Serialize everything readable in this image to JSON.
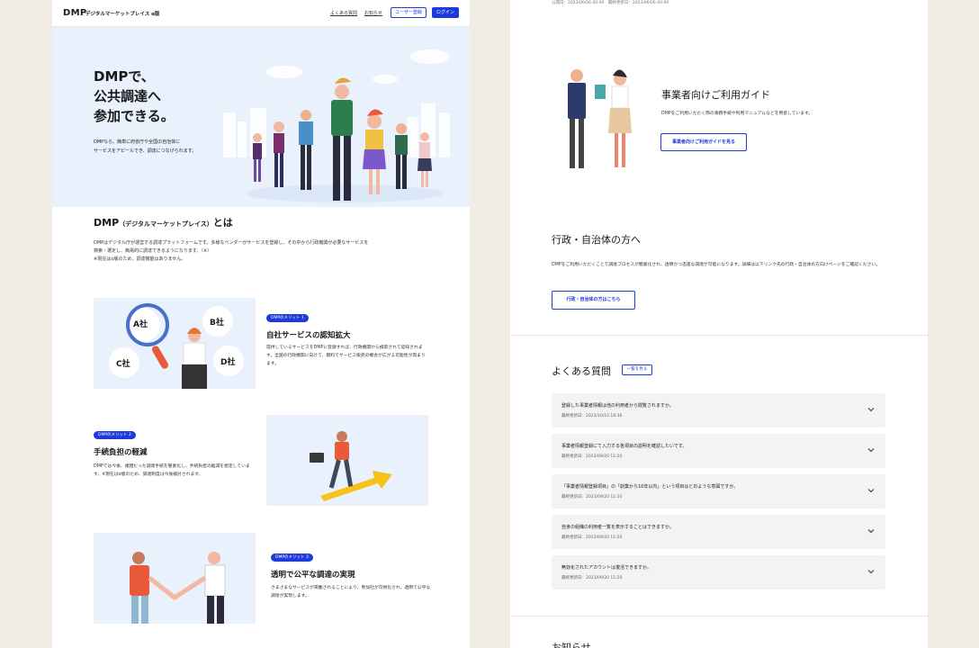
{
  "left": {
    "header": {
      "logo": "DMP",
      "logo_sub": "デジタルマーケットプレイス α版",
      "links": [
        "よくある質問",
        "お知らせ"
      ],
      "register_label": "ユーザー登録",
      "login_label": "ログイン"
    },
    "hero": {
      "title": "DMPで、\n公共調達へ\n参加できる。",
      "desc": "DMPなら、簡単に府省庁や全国の自治体に\nサービスをアピールでき、調達につなげられます。"
    },
    "about": {
      "title_main": "DMP",
      "title_paren": "（デジタルマーケットプレイス）",
      "title_suffix": "とは",
      "text": "DMPはデジタル庁が運営する調達プラットフォームです。多様なベンダーがサービスを登録し、その中から行政機関が必要なサービスを\n検索・選定し、簡易的に調達できるようになります。（※）\n※現在はα版のため、調達機能はありません。"
    },
    "merits": [
      {
        "badge": "DMPのメリット 1",
        "title": "自社サービスの認知拡大",
        "text": "提供しているサービスをDMPに登録すれば、行政機関から検索されて認知されます。全国の行政機関に向けて、無料でサービス販売の機会が広がる可能性が高まります。",
        "companies": [
          "A社",
          "B社",
          "C社",
          "D社"
        ]
      },
      {
        "badge": "DMPのメリット 2",
        "title": "手続負担の軽減",
        "text": "DMPでは今後、複雑だった調達手続を簡素化し、手続負担の軽減を想定しています。※現在はα版のため、調達制度は今後検討されます。"
      },
      {
        "badge": "DMPのメリット 3",
        "title": "透明で公平な調達の実現",
        "text": "さまざまなサービスが掲載されることにより、参加社が可視化され、透明で公平な調達が実現します。"
      }
    ]
  },
  "right": {
    "date_line": "公開日：2023/06/06 00:00　最終更新日：2023/06/06 00:00",
    "guide": {
      "title": "事業者向けご利用ガイド",
      "desc": "DMPをご利用いただく際の事務手続や利用マニュアルなどを用意しています。",
      "button": "事業者向けご利用ガイドを見る"
    },
    "gov": {
      "title": "行政・自治体の方へ",
      "desc": "DMPをご利用いただくことで調達プロセスが簡素化され、透明かつ迅速な調達が可能になります。詳細は以下リンク先の行政・自治体の方向けページをご確認ください。",
      "button": "行政・自治体の方はこちら"
    },
    "faq": {
      "title": "よくある質問",
      "more": "一覧を見る",
      "items": [
        {
          "q": "登録した事業者情報は他の利用者から閲覧されますか。",
          "date": "最終更新日：2023/10/10 18:36"
        },
        {
          "q": "事業者情報登録にて入力する各項目の説明を確認したいです。",
          "date": "最終更新日：2023/09/20 11:20"
        },
        {
          "q": "「事業者情報登録項目」の「創業から10年以内」という項目はどのような意図ですか。",
          "date": "最終更新日：2023/09/20 11:20"
        },
        {
          "q": "自身の組織の利用者一覧を表示することはできますか。",
          "date": "最終更新日：2023/09/20 11:20"
        },
        {
          "q": "無効化されたアカウントは復活できますか。",
          "date": "最終更新日：2023/09/20 11:20"
        }
      ]
    },
    "next_title": "お知らせ"
  }
}
